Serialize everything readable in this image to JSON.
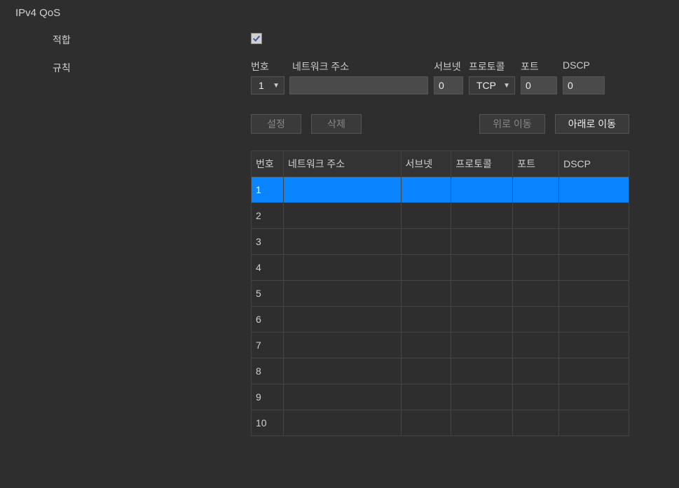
{
  "title": "IPv4 QoS",
  "labels": {
    "apply": "적합",
    "rules": "규칙"
  },
  "checkbox": {
    "apply_checked": true
  },
  "field_headers": {
    "num": "번호",
    "addr": "네트워크 주소",
    "subnet": "서브넷",
    "proto": "프로토콜",
    "port": "포트",
    "dscp": "DSCP"
  },
  "inputs": {
    "num_selected": "1",
    "addr_value": "",
    "subnet_value": "0",
    "proto_selected": "TCP",
    "port_value": "0",
    "dscp_value": "0"
  },
  "buttons": {
    "set": "설정",
    "delete": "삭제",
    "move_up": "위로 이동",
    "move_down": "아래로 이동"
  },
  "table": {
    "headers": {
      "num": "번호",
      "addr": "네트워크 주소",
      "subnet": "서브넷",
      "proto": "프로토콜",
      "port": "포트",
      "dscp": "DSCP"
    },
    "rows": [
      {
        "num": "1",
        "addr": "",
        "subnet": "",
        "proto": "",
        "port": "",
        "dscp": "",
        "selected": true
      },
      {
        "num": "2",
        "addr": "",
        "subnet": "",
        "proto": "",
        "port": "",
        "dscp": "",
        "selected": false
      },
      {
        "num": "3",
        "addr": "",
        "subnet": "",
        "proto": "",
        "port": "",
        "dscp": "",
        "selected": false
      },
      {
        "num": "4",
        "addr": "",
        "subnet": "",
        "proto": "",
        "port": "",
        "dscp": "",
        "selected": false
      },
      {
        "num": "5",
        "addr": "",
        "subnet": "",
        "proto": "",
        "port": "",
        "dscp": "",
        "selected": false
      },
      {
        "num": "6",
        "addr": "",
        "subnet": "",
        "proto": "",
        "port": "",
        "dscp": "",
        "selected": false
      },
      {
        "num": "7",
        "addr": "",
        "subnet": "",
        "proto": "",
        "port": "",
        "dscp": "",
        "selected": false
      },
      {
        "num": "8",
        "addr": "",
        "subnet": "",
        "proto": "",
        "port": "",
        "dscp": "",
        "selected": false
      },
      {
        "num": "9",
        "addr": "",
        "subnet": "",
        "proto": "",
        "port": "",
        "dscp": "",
        "selected": false
      },
      {
        "num": "10",
        "addr": "",
        "subnet": "",
        "proto": "",
        "port": "",
        "dscp": "",
        "selected": false
      }
    ]
  }
}
